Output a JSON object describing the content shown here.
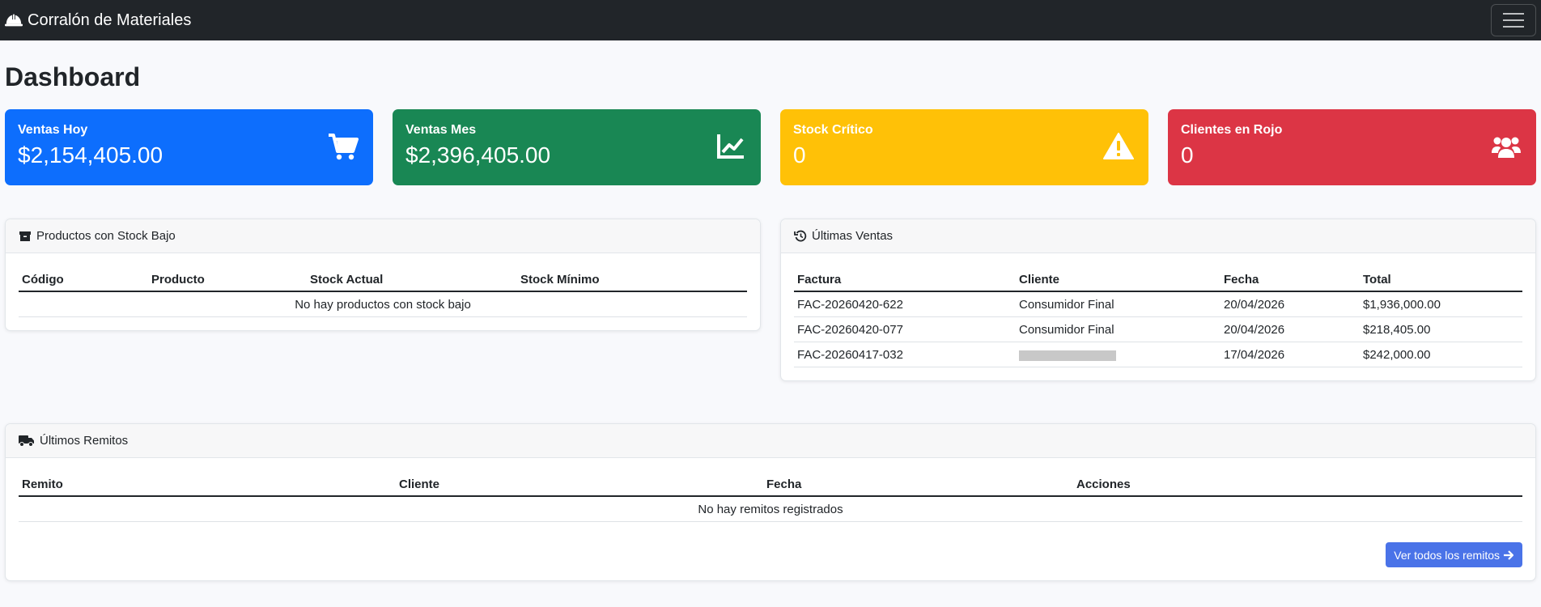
{
  "app": {
    "title": "Corralón de Materiales"
  },
  "page": {
    "title": "Dashboard"
  },
  "stats": [
    {
      "label": "Ventas Hoy",
      "value": "$2,154,405.00",
      "icon": "cart-icon",
      "color": "#0d6efd"
    },
    {
      "label": "Ventas Mes",
      "value": "$2,396,405.00",
      "icon": "chart-line-icon",
      "color": "#198754"
    },
    {
      "label": "Stock Crítico",
      "value": "0",
      "icon": "warning-icon",
      "color": "#ffc107"
    },
    {
      "label": "Clientes en Rojo",
      "value": "0",
      "icon": "users-icon",
      "color": "#dc3545"
    }
  ],
  "low_stock": {
    "title": "Productos con Stock Bajo",
    "columns": [
      "Código",
      "Producto",
      "Stock Actual",
      "Stock Mínimo"
    ],
    "empty": "No hay productos con stock bajo"
  },
  "last_sales": {
    "title": "Últimas Ventas",
    "columns": [
      "Factura",
      "Cliente",
      "Fecha",
      "Total"
    ],
    "rows": [
      {
        "factura": "FAC-20260420-622",
        "cliente": "Consumidor Final",
        "fecha": "20/04/2026",
        "total": "$1,936,000.00"
      },
      {
        "factura": "FAC-20260420-077",
        "cliente": "Consumidor Final",
        "fecha": "20/04/2026",
        "total": "$218,405.00"
      },
      {
        "factura": "FAC-20260417-032",
        "cliente": "",
        "fecha": "17/04/2026",
        "total": "$242,000.00"
      }
    ]
  },
  "remitos": {
    "title": "Últimos Remitos",
    "columns": [
      "Remito",
      "Cliente",
      "Fecha",
      "Acciones"
    ],
    "empty": "No hay remitos registrados",
    "button": "Ver todos los remitos"
  }
}
